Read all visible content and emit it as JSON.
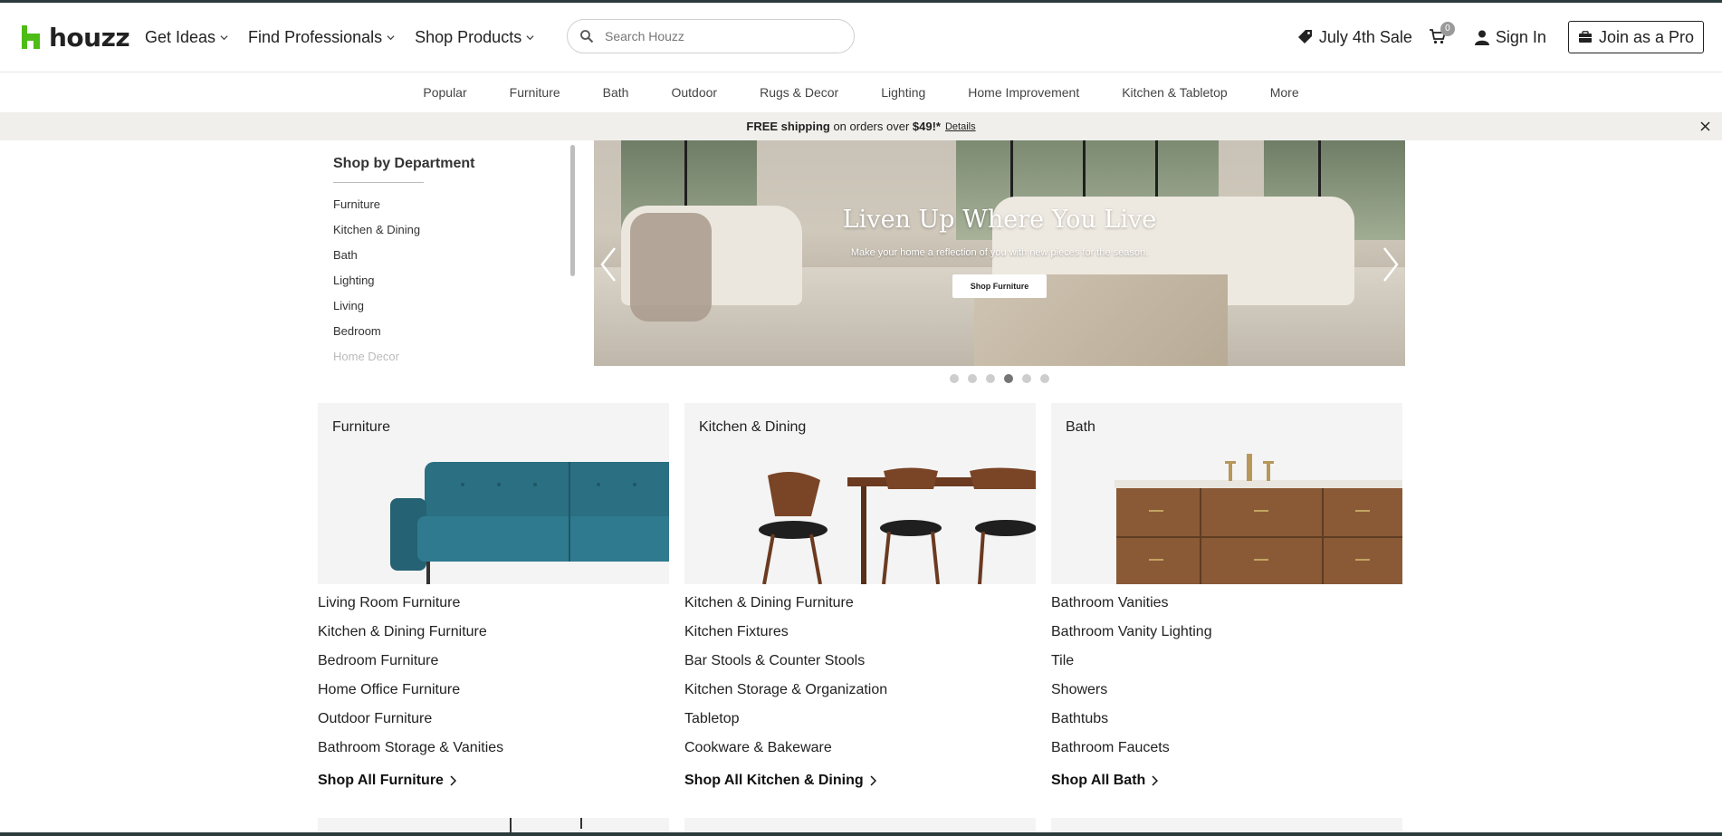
{
  "header": {
    "logo_text": "houzz",
    "nav": [
      {
        "label": "Get Ideas"
      },
      {
        "label": "Find Professionals"
      },
      {
        "label": "Shop Products"
      }
    ],
    "search_placeholder": "Search Houzz",
    "sale_label": "July 4th Sale",
    "cart_count": "0",
    "signin_label": "Sign In",
    "join_label": "Join as a Pro"
  },
  "subnav": [
    "Popular",
    "Furniture",
    "Bath",
    "Outdoor",
    "Rugs & Decor",
    "Lighting",
    "Home Improvement",
    "Kitchen & Tabletop",
    "More"
  ],
  "promo": {
    "bold": "FREE shipping",
    "middle": " on orders over ",
    "amount": "$49!*",
    "details": "Details"
  },
  "department": {
    "title": "Shop by Department",
    "items": [
      "Furniture",
      "Kitchen & Dining",
      "Bath",
      "Lighting",
      "Living",
      "Bedroom",
      "Home Decor"
    ]
  },
  "hero": {
    "title": "Liven Up Where You Live",
    "subtitle": "Make your home a reflection of you with new pieces for the season.",
    "button": "Shop Furniture",
    "dots_total": 6,
    "dots_active_index": 3
  },
  "categories": [
    {
      "title": "Furniture",
      "links": [
        "Living Room Furniture",
        "Kitchen & Dining Furniture",
        "Bedroom Furniture",
        "Home Office Furniture",
        "Outdoor Furniture",
        "Bathroom Storage & Vanities"
      ],
      "shop_all": "Shop All Furniture"
    },
    {
      "title": "Kitchen & Dining",
      "links": [
        "Kitchen & Dining Furniture",
        "Kitchen Fixtures",
        "Bar Stools & Counter Stools",
        "Kitchen Storage & Organization",
        "Tabletop",
        "Cookware & Bakeware"
      ],
      "shop_all": "Shop All Kitchen & Dining"
    },
    {
      "title": "Bath",
      "links": [
        "Bathroom Vanities",
        "Bathroom Vanity Lighting",
        "Tile",
        "Showers",
        "Bathtubs",
        "Bathroom Faucets"
      ],
      "shop_all": "Shop All Bath"
    }
  ],
  "colors": {
    "brand_green": "#4dbc15",
    "text": "#222222",
    "promo_bg": "#f0efec",
    "card_bg": "#f4f4f4"
  }
}
